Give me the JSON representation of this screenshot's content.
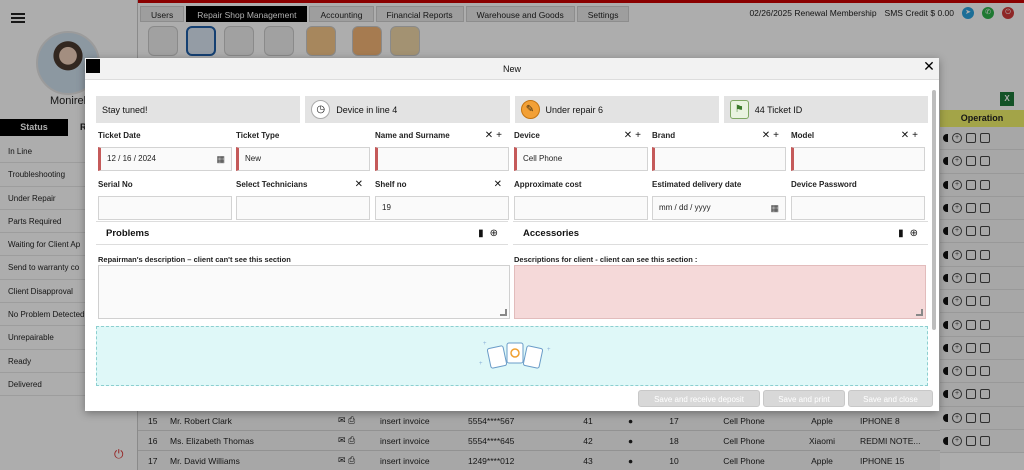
{
  "sidebar": {
    "username": "Monirel",
    "status_tab": "Status",
    "second_tab": "R",
    "items": [
      "In Line",
      "Troubleshooting",
      "Under Repair",
      "Parts Required",
      "Waiting for Client Ap",
      "Send to warranty co",
      "Client Disapproval",
      "No Problem Detected",
      "Unrepairable",
      "Ready",
      "Delivered"
    ]
  },
  "topbar": {
    "tabs": [
      "Users",
      "Repair Shop Management",
      "Accounting",
      "Financial Reports",
      "Warehouse and Goods",
      "Settings"
    ],
    "active_tab": 1,
    "renewal": "02/26/2025 Renewal Membership",
    "sms_credit": "SMS Credit $ 0.00"
  },
  "table": {
    "operation_header": "Operation",
    "rows": [
      {
        "no": "15",
        "name": "Mr. Robert Clark",
        "invoice": "insert invoice",
        "phone": "5554****567",
        "a": "41",
        "b": "17",
        "device": "Cell Phone",
        "brand": "Apple",
        "model": "IPHONE 8"
      },
      {
        "no": "16",
        "name": "Ms. Elizabeth Thomas",
        "invoice": "insert invoice",
        "phone": "5554****645",
        "a": "42",
        "b": "18",
        "device": "Cell Phone",
        "brand": "Xiaomi",
        "model": "REDMI NOTE..."
      },
      {
        "no": "17",
        "name": "Mr. David Williams",
        "invoice": "insert invoice",
        "phone": "1249****012",
        "a": "43",
        "b": "10",
        "device": "Cell Phone",
        "brand": "Apple",
        "model": "IPHONE 15"
      }
    ]
  },
  "modal": {
    "title": "New",
    "cards": [
      {
        "label": "Stay tuned!",
        "icon": "none"
      },
      {
        "label": "Device in line 4",
        "icon": "clock-icon"
      },
      {
        "label": "Under repair  6",
        "icon": "wrench-icon"
      },
      {
        "label": "44 Ticket ID",
        "icon": "siren-icon"
      }
    ],
    "fields": {
      "ticket_date": {
        "label": "Ticket Date",
        "value": "12 / 16 / 2024"
      },
      "ticket_type": {
        "label": "Ticket Type",
        "value": "New"
      },
      "name_surname": {
        "label": "Name and Surname",
        "value": ""
      },
      "device": {
        "label": "Device",
        "value": "Cell Phone"
      },
      "brand": {
        "label": "Brand",
        "value": ""
      },
      "model": {
        "label": "Model",
        "value": ""
      },
      "serial_no": {
        "label": "Serial No",
        "value": ""
      },
      "technicians": {
        "label": "Select Technicians",
        "value": ""
      },
      "shelf_no": {
        "label": "Shelf no",
        "value": "19"
      },
      "approx_cost": {
        "label": "Approximate cost",
        "value": ""
      },
      "delivery_date": {
        "label": "Estimated delivery date",
        "value": "mm / dd / yyyy"
      },
      "device_password": {
        "label": "Device Password",
        "value": ""
      }
    },
    "problems_title": "Problems",
    "accessories_title": "Accessories",
    "repairman_desc_label": "Repairman's description – client can't see this section",
    "client_desc_label": "Descriptions for client - client can see this section :",
    "buttons": {
      "save_deposit": "Save and receive deposit",
      "save_print": "Save and print",
      "save_close": "Save and close"
    }
  }
}
